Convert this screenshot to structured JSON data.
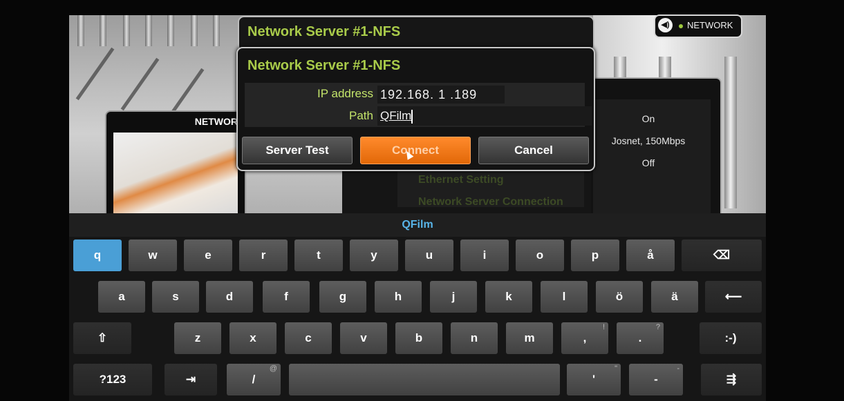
{
  "badge": {
    "label": "NETWORK",
    "icon": "audio-icon"
  },
  "background": {
    "network_panel_label": "NETWOR",
    "info_values": [
      "On",
      "Josnet, 150Mbps",
      "Off"
    ],
    "menu_items": [
      "Ethernet Setting",
      "Network Server Connection"
    ]
  },
  "dialog_back": {
    "title": "Network Server #1-NFS"
  },
  "dialog": {
    "title": "Network Server #1-NFS",
    "ip_label": "IP address",
    "ip_value": "192.168. 1 .189",
    "path_label": "Path",
    "path_value": "QFilm",
    "buttons": {
      "server_test": "Server Test",
      "connect": "Connect",
      "cancel": "Cancel"
    }
  },
  "keyboard": {
    "preview": "QFilm",
    "row1": [
      "q",
      "w",
      "e",
      "r",
      "t",
      "y",
      "u",
      "i",
      "o",
      "p",
      "å"
    ],
    "row2": [
      "a",
      "s",
      "d",
      "f",
      "g",
      "h",
      "j",
      "k",
      "l",
      "ö",
      "ä"
    ],
    "row3": [
      "z",
      "x",
      "c",
      "v",
      "b",
      "n",
      "m",
      ",",
      "."
    ],
    "row3_alt": {
      "comma": "!",
      "period": "?"
    },
    "smiley": ":-)",
    "mode": "?123",
    "slash": "/",
    "slash_alt": "@",
    "apostrophe": "'",
    "apostrophe_alt": "\"",
    "dash": "-",
    "dash_alt": "-",
    "settings": "⇶"
  }
}
